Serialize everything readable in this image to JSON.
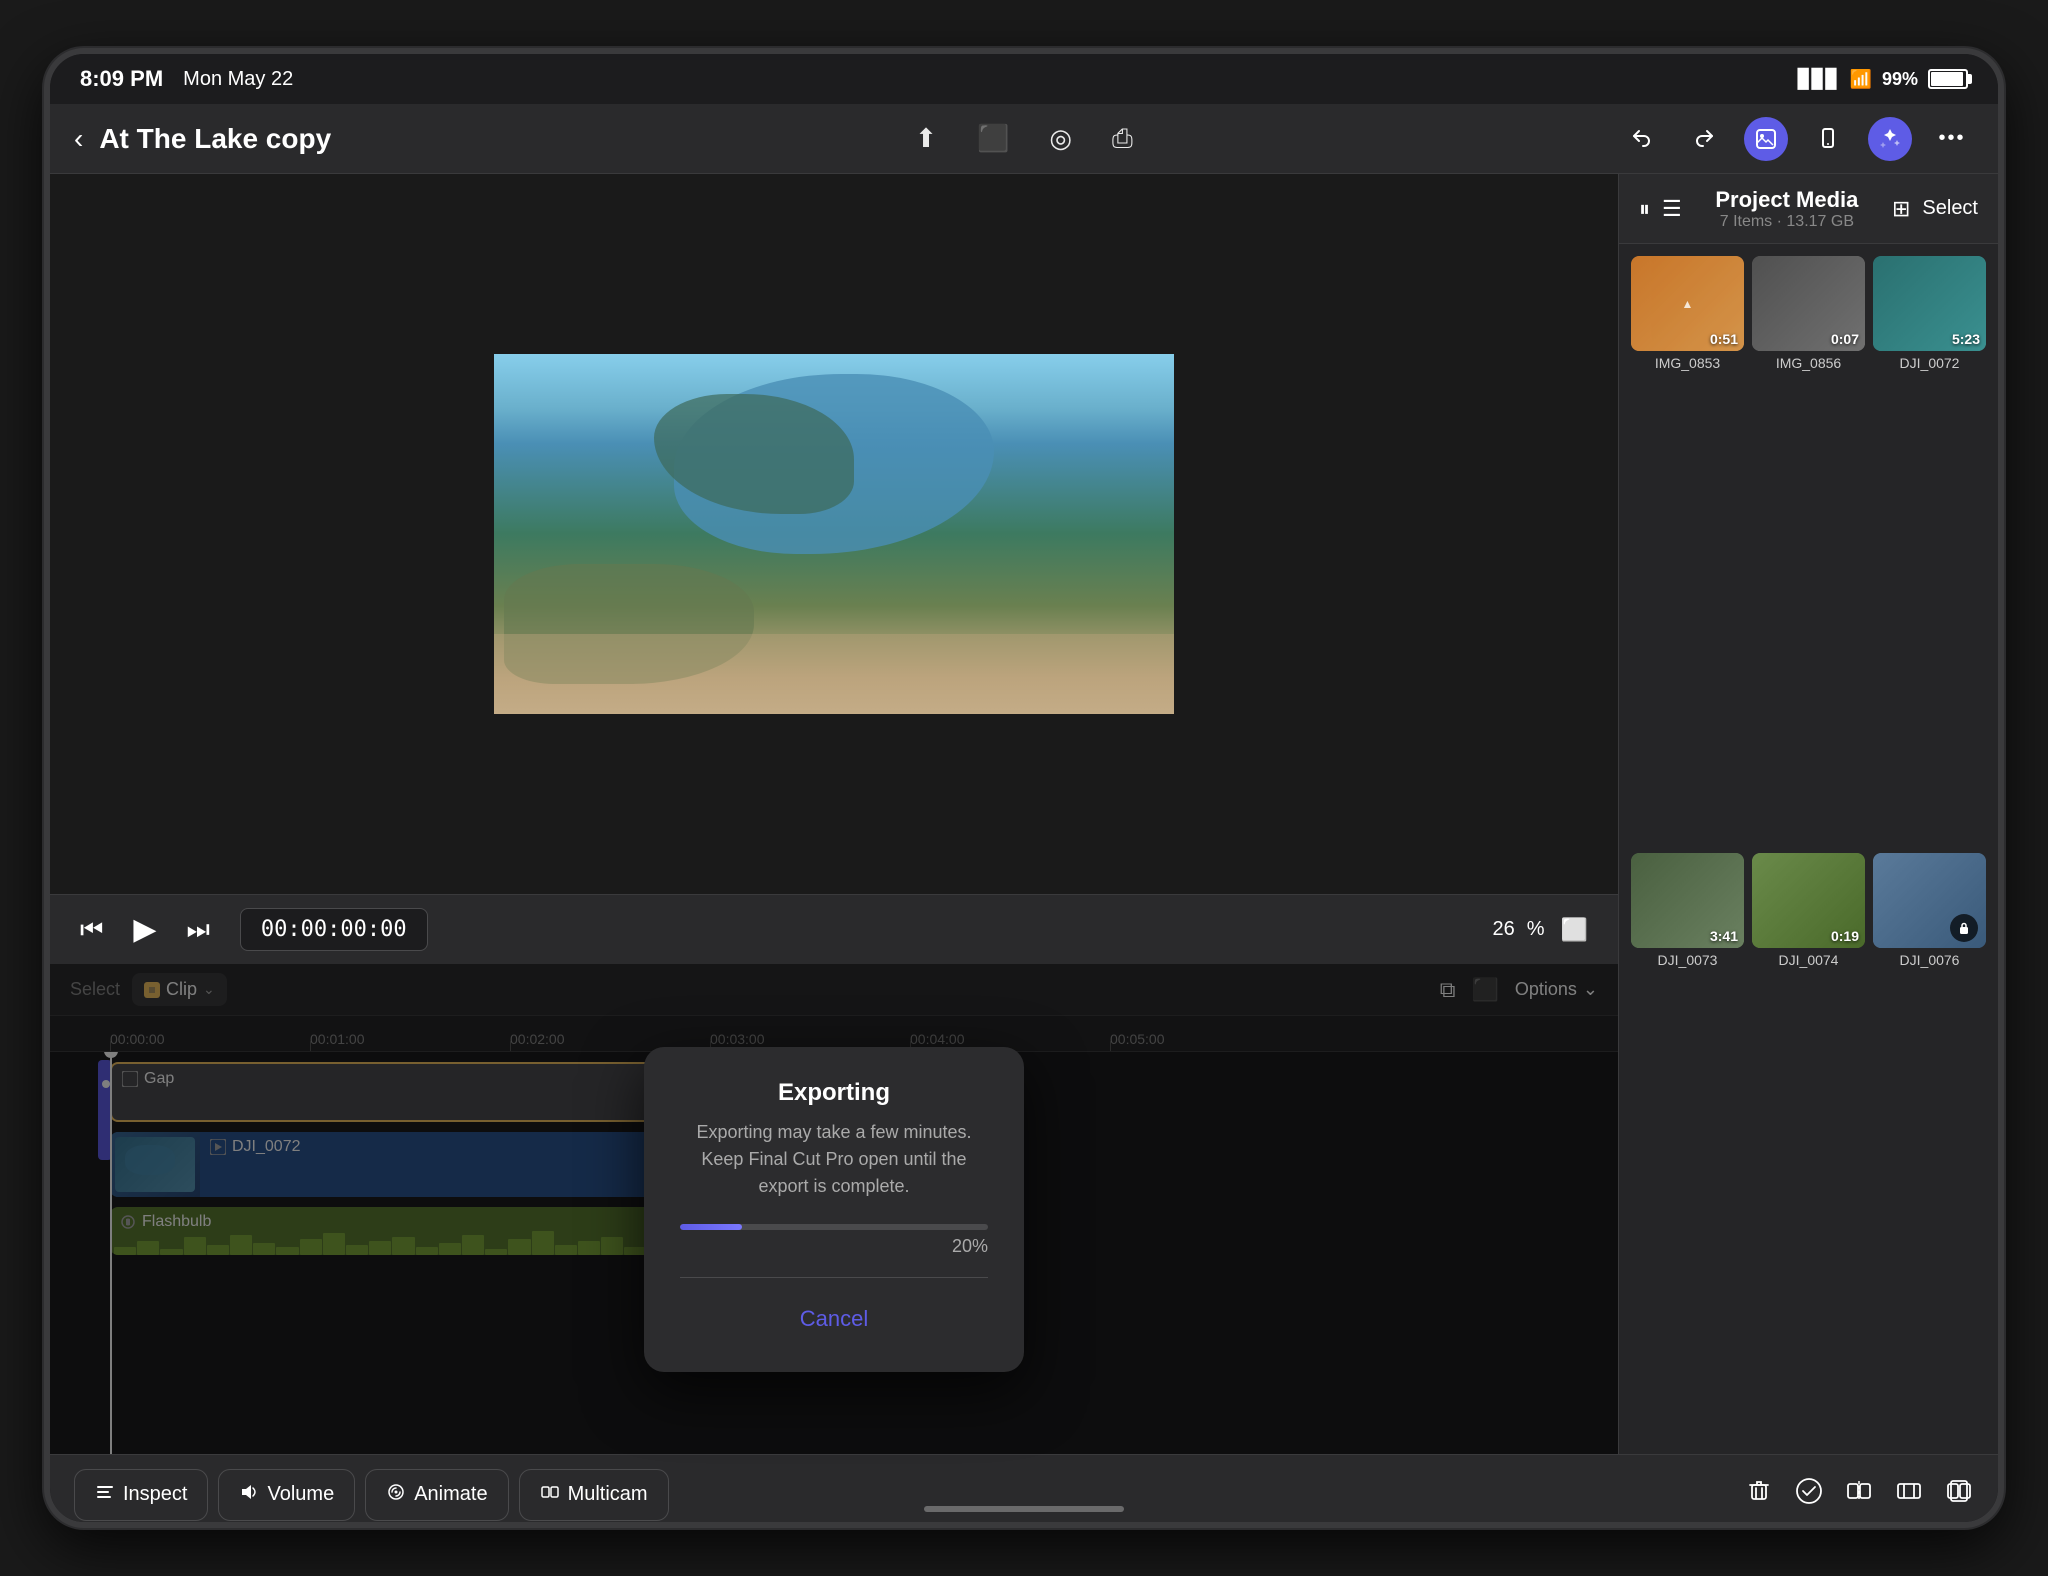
{
  "status_bar": {
    "time": "8:09 PM",
    "date": "Mon May 22",
    "battery": "99%"
  },
  "top_toolbar": {
    "back_label": "‹",
    "project_title": "At The Lake copy",
    "icons": {
      "export": "⬆",
      "camera": "📷",
      "location": "⊕",
      "share": "⎙"
    },
    "right_icons": {
      "undo": "↩",
      "redo": "↪",
      "photos": "🖼",
      "device": "📱",
      "eye": "👁",
      "more": "•••"
    }
  },
  "playback": {
    "skip_back": "⏮",
    "play": "▶",
    "skip_forward": "⏭",
    "timecode": "00:00:00:00",
    "zoom_label": "26",
    "zoom_unit": "%"
  },
  "right_panel": {
    "title": "Project Media",
    "subtitle": "7 Items · 13.17 GB",
    "select_label": "Select",
    "media_items": [
      {
        "name": "IMG_0853",
        "duration": "0:51",
        "color": "thumb-orange"
      },
      {
        "name": "IMG_0856",
        "duration": "0:07",
        "color": "thumb-gray"
      },
      {
        "name": "DJI_0072",
        "duration": "5:23",
        "color": "thumb-teal"
      },
      {
        "name": "DJI_0073",
        "duration": "3:41",
        "color": "thumb-aerial"
      },
      {
        "name": "DJI_0074",
        "duration": "0:19",
        "color": "thumb-field"
      },
      {
        "name": "DJI_0076",
        "duration": "",
        "color": "thumb-suburb"
      }
    ]
  },
  "timeline": {
    "select_label": "Select",
    "clip_type": "Clip",
    "options_label": "Options",
    "ruler_marks": [
      "00:00:00",
      "00:01:00",
      "00:02:00",
      "00:03:00",
      "00:04:00",
      "00:05:00"
    ],
    "tracks": [
      {
        "type": "gap",
        "label": "Gap",
        "color": "#4a4a4e"
      },
      {
        "type": "video",
        "label": "DJI_0072",
        "color": "#2a5490"
      },
      {
        "type": "audio",
        "label": "Flashbulb",
        "color": "#5a7a30"
      }
    ]
  },
  "export_dialog": {
    "title": "Exporting",
    "message": "Exporting may take a few minutes. Keep Final Cut Pro open until the export is complete.",
    "progress": 20,
    "progress_text": "20%",
    "cancel_label": "Cancel"
  },
  "bottom_toolbar": {
    "inspect_label": "Inspect",
    "volume_label": "Volume",
    "animate_label": "Animate",
    "multicam_label": "Multicam",
    "action_icons": {
      "delete": "🗑",
      "check": "✓",
      "split": "⧉",
      "trim": "⧊",
      "crop": "⧌"
    }
  }
}
